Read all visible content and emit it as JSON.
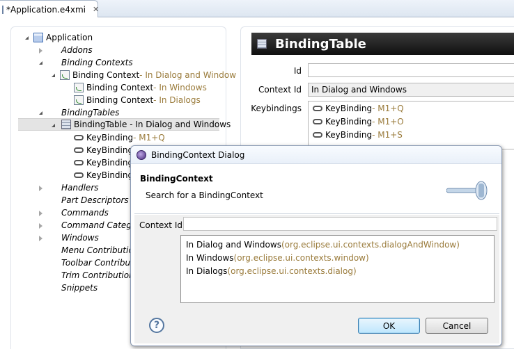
{
  "tab": {
    "title": "*Application.e4xmi",
    "close": "✕"
  },
  "tree": {
    "root": {
      "label": "Application"
    },
    "addons": {
      "label": "Addons"
    },
    "binding_contexts": {
      "label": "Binding Contexts"
    },
    "ctx_dialog_windows": {
      "label": "Binding Context",
      "suffix": " - In Dialog and Window"
    },
    "ctx_windows": {
      "label": "Binding Context",
      "suffix": " - In Windows"
    },
    "ctx_dialogs": {
      "label": "Binding Context",
      "suffix": " - In Dialogs"
    },
    "binding_tables": {
      "label": "BindingTables"
    },
    "binding_table": {
      "label": "BindingTable - In Dialog and Windows"
    },
    "kb1": {
      "label": "KeyBinding",
      "suffix": " - M1+Q"
    },
    "kb2": {
      "label": "KeyBinding"
    },
    "kb3": {
      "label": "KeyBinding"
    },
    "kb4": {
      "label": "KeyBinding"
    },
    "handlers": {
      "label": "Handlers"
    },
    "part_descriptors": {
      "label": "Part Descriptors"
    },
    "commands": {
      "label": "Commands"
    },
    "command_categories": {
      "label": "Command Categor"
    },
    "windows": {
      "label": "Windows"
    },
    "menu_contributions": {
      "label": "Menu Contribution"
    },
    "toolbar_contributions": {
      "label": "Toolbar Contributio"
    },
    "trim_contributions": {
      "label": "Trim Contributions"
    },
    "snippets": {
      "label": "Snippets"
    }
  },
  "detail": {
    "title": "BindingTable",
    "id_label": "Id",
    "id_value": "",
    "context_id_label": "Context Id",
    "context_id_value": "In Dialog and Windows",
    "keybindings_label": "Keybindings",
    "keybindings": [
      {
        "label": "KeyBinding",
        "suffix": " - M1+Q"
      },
      {
        "label": "KeyBinding",
        "suffix": " - M1+O"
      },
      {
        "label": "KeyBinding",
        "suffix": " - M1+S"
      }
    ]
  },
  "dialog": {
    "title": "BindingContext Dialog",
    "banner_title": "BindingContext",
    "banner_message": "Search for a BindingContext",
    "context_id_label": "Context Id",
    "context_id_value": "",
    "results": [
      {
        "label": "In Dialog and Windows",
        "suffix": " (org.eclipse.ui.contexts.dialogAndWindow)"
      },
      {
        "label": "In Windows",
        "suffix": " (org.eclipse.ui.contexts.window)"
      },
      {
        "label": "In Dialogs",
        "suffix": " (org.eclipse.ui.contexts.dialog)"
      }
    ],
    "help": "?",
    "ok_label": "OK",
    "cancel_label": "Cancel"
  }
}
